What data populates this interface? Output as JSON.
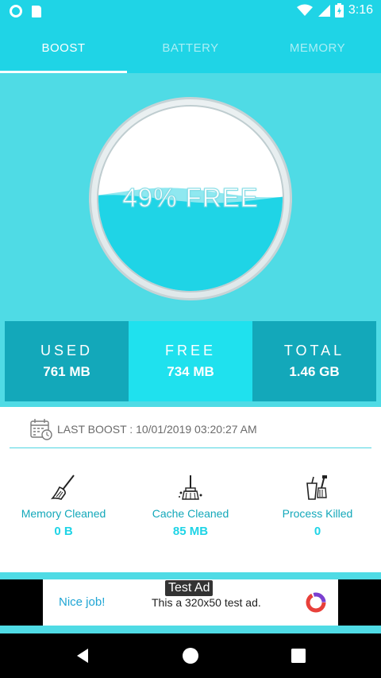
{
  "status_bar": {
    "time": "3:16",
    "icons": [
      "circle-notification-icon",
      "sd-card-icon",
      "wifi-icon",
      "signal-icon",
      "battery-charging-icon"
    ]
  },
  "tabs": [
    {
      "label": "BOOST",
      "active": true
    },
    {
      "label": "BATTERY",
      "active": false
    },
    {
      "label": "MEMORY",
      "active": false
    }
  ],
  "gauge": {
    "text": "49% FREE",
    "free_fraction": 0.49
  },
  "stats": [
    {
      "label": "USED",
      "value": "761 MB"
    },
    {
      "label": "FREE",
      "value": "734 MB"
    },
    {
      "label": "TOTAL",
      "value": "1.46 GB"
    }
  ],
  "last_boost": {
    "text": "LAST BOOST : 10/01/2019 03:20:27 AM",
    "icon": "calendar-clock-icon"
  },
  "metrics": [
    {
      "label": "Memory Cleaned",
      "value": "0 B",
      "icon": "broom-icon"
    },
    {
      "label": "Cache Cleaned",
      "value": "85 MB",
      "icon": "cache-broom-icon"
    },
    {
      "label": "Process Killed",
      "value": "0",
      "icon": "dustpan-icon"
    }
  ],
  "ad": {
    "badge": "Test Ad",
    "headline": "Nice job!",
    "body": "This a 320x50 test ad."
  },
  "navbar": {
    "icons": [
      "back-icon",
      "home-icon",
      "recents-icon"
    ]
  },
  "colors": {
    "primary": "#1fd4e6",
    "dark": "#13a8ba",
    "background": "#4fdbe5"
  }
}
